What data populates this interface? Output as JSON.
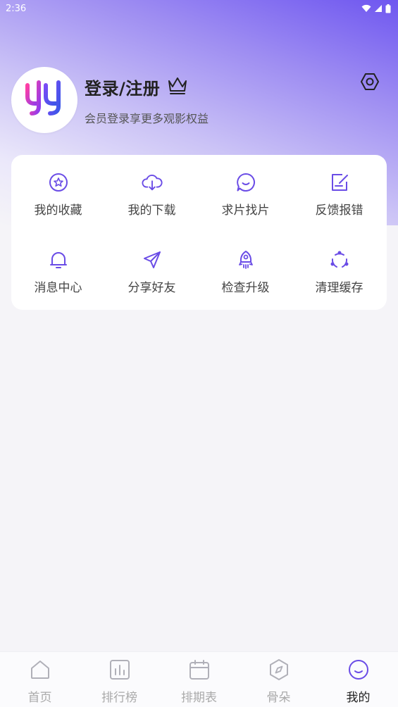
{
  "status_bar": {
    "time": "2:36"
  },
  "profile": {
    "login_title": "登录/注册",
    "subtitle": "会员登录享更多观影权益"
  },
  "menu": [
    {
      "label": "我的收藏",
      "icon": "star-icon"
    },
    {
      "label": "我的下载",
      "icon": "cloud-download-icon"
    },
    {
      "label": "求片找片",
      "icon": "chat-bubble-icon"
    },
    {
      "label": "反馈报错",
      "icon": "edit-note-icon"
    },
    {
      "label": "消息中心",
      "icon": "bell-icon"
    },
    {
      "label": "分享好友",
      "icon": "paper-plane-icon"
    },
    {
      "label": "检查升级",
      "icon": "rocket-icon"
    },
    {
      "label": "清理缓存",
      "icon": "refresh-cycle-icon"
    }
  ],
  "tabs": [
    {
      "label": "首页",
      "icon": "home-icon"
    },
    {
      "label": "排行榜",
      "icon": "ranking-chart-icon"
    },
    {
      "label": "排期表",
      "icon": "calendar-icon"
    },
    {
      "label": "骨朵",
      "icon": "compass-icon"
    },
    {
      "label": "我的",
      "icon": "smile-icon",
      "active": true
    }
  ],
  "colors": {
    "accent": "#6a4ce6",
    "header_gradient_start": "#6e56f0",
    "background": "#f5f4f8",
    "tab_inactive": "#aaaaaa",
    "tab_active_label": "#222222"
  }
}
